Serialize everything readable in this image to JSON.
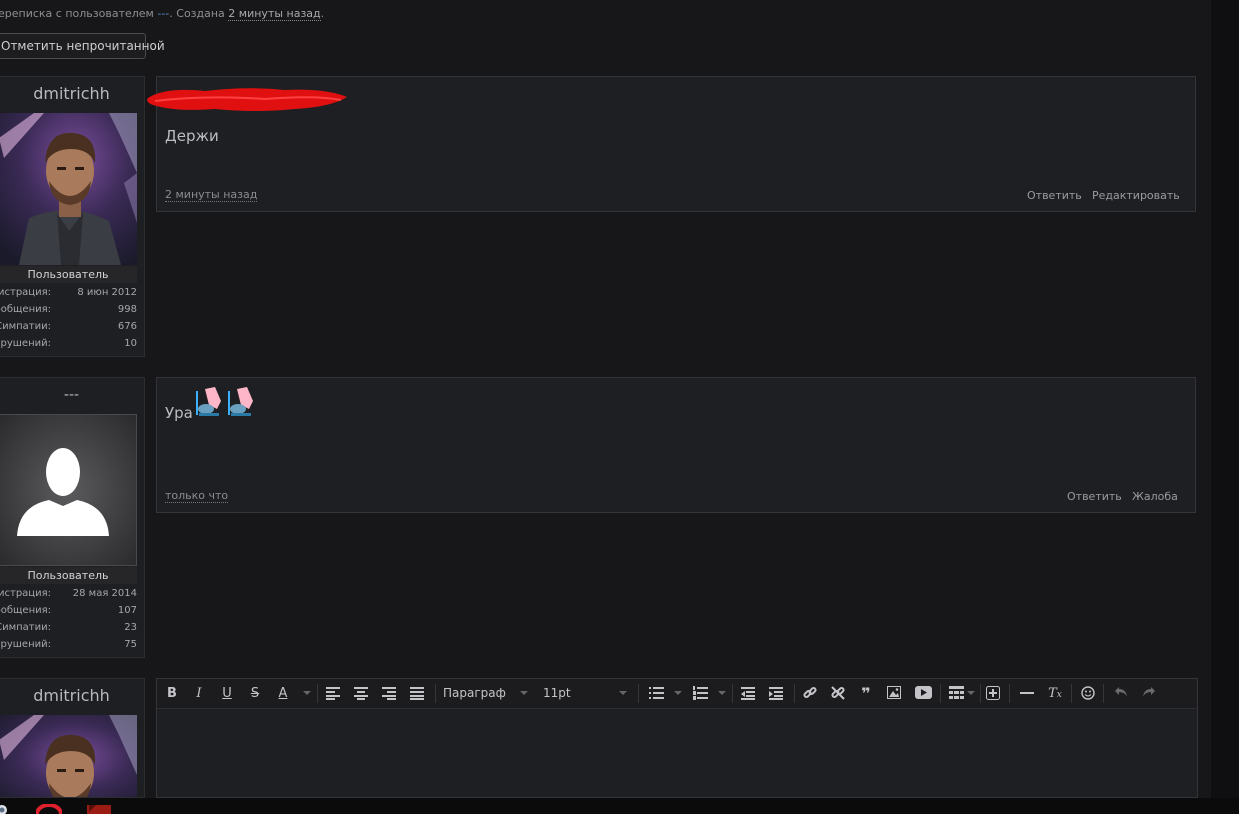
{
  "header": {
    "info_prefix": "ереписка с пользователем ",
    "partner_link": "---",
    "info_middle": ". Создана ",
    "created_ago": "2 минуты назад",
    "info_end": ".",
    "mark_unread_button": "Отметить непрочитанной"
  },
  "posts": [
    {
      "author": "dmitrichh",
      "role": "Пользователь",
      "stats": [
        {
          "key": "Регистрация:",
          "value": "8 июн 2012"
        },
        {
          "key": "Сообщения:",
          "value": "998"
        },
        {
          "key": "Симпатии:",
          "value": "676"
        },
        {
          "key": "Баллы нарушений:",
          "value": "10"
        }
      ],
      "text": "Держи",
      "time": "2 минуты назад",
      "actions": [
        "Ответить",
        "Редактировать"
      ]
    },
    {
      "author": "---",
      "role": "Пользователь",
      "stats": [
        {
          "key": "Регистрация:",
          "value": "28 мая 2014"
        },
        {
          "key": "Сообщения:",
          "value": "107"
        },
        {
          "key": "Симпатии:",
          "value": "23"
        },
        {
          "key": "Баллы нарушений:",
          "value": "75"
        }
      ],
      "text": "Ура",
      "time": "только что",
      "actions": [
        "Ответить",
        "Жалоба"
      ]
    }
  ],
  "reply": {
    "author": "dmitrichh",
    "paragraph_select": "Параграф",
    "font_size_select": "11pt",
    "toolbar_icons": [
      "bold-icon",
      "italic-icon",
      "underline-icon",
      "strikethrough-icon",
      "text-color-icon",
      "align-left-icon",
      "align-center-icon",
      "align-right-icon",
      "align-justify-icon",
      "bullet-list-icon",
      "numbered-list-icon",
      "outdent-icon",
      "indent-icon",
      "link-icon",
      "unlink-icon",
      "quote-icon",
      "image-icon",
      "video-icon",
      "table-icon",
      "insert-icon",
      "horizontal-rule-icon",
      "clear-format-icon",
      "smiley-icon",
      "undo-icon",
      "redo-icon"
    ]
  },
  "colors": {
    "background": "#17171a",
    "panel": "#1e1f22",
    "border": "#34353a",
    "link": "#5a8fc9"
  }
}
